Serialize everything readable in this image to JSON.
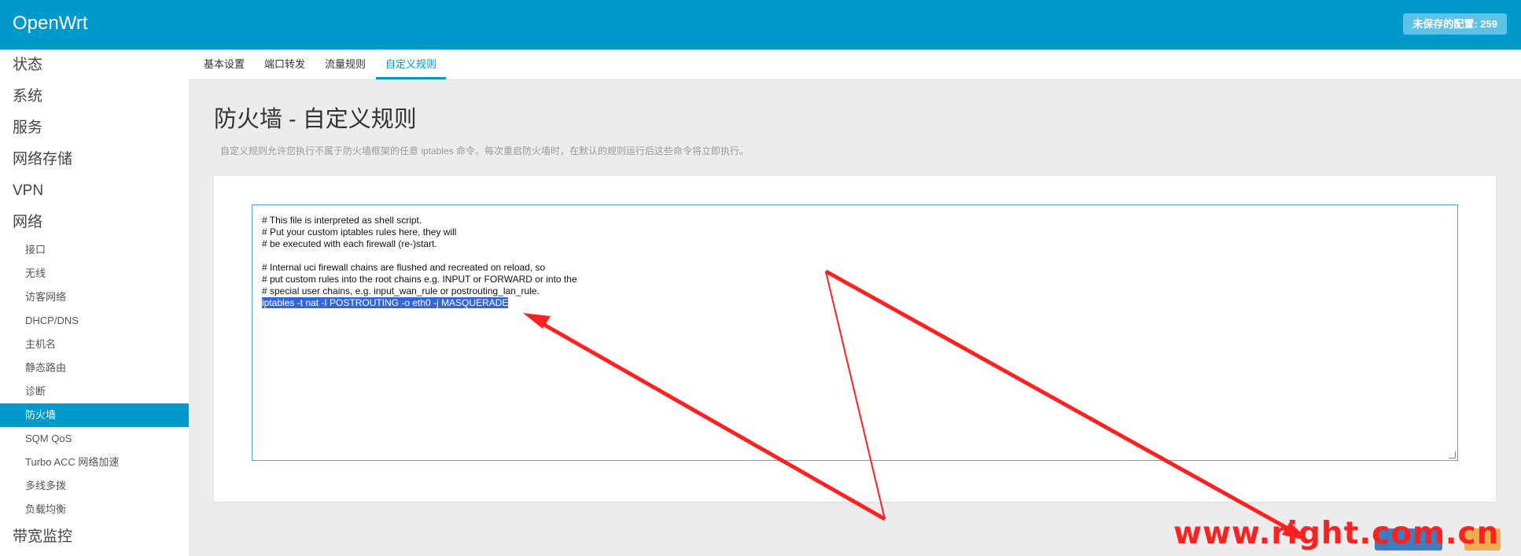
{
  "header": {
    "brand": "OpenWrt",
    "unsaved_badge": "未保存的配置: 259"
  },
  "sidebar": {
    "top_items": [
      "状态",
      "系统",
      "服务",
      "网络存储",
      "VPN",
      "网络"
    ],
    "network_items": [
      "接口",
      "无线",
      "访客网络",
      "DHCP/DNS",
      "主机名",
      "静态路由",
      "诊断",
      "防火墙",
      "SQM QoS",
      "Turbo ACC 网络加速",
      "多线多拨",
      "负载均衡"
    ],
    "active_item": "防火墙",
    "bottom_item": "带宽监控"
  },
  "tabs": [
    "基本设置",
    "端口转发",
    "流量规则",
    "自定义规则"
  ],
  "active_tab": "自定义规则",
  "page": {
    "title": "防火墙 - 自定义规则",
    "description": "自定义规则允许您执行不属于防火墙框架的任意 iptables 命令。每次重启防火墙时，在默认的规则运行后这些命令将立即执行。"
  },
  "editor": {
    "lines": [
      "# This file is interpreted as shell script.",
      "# Put your custom iptables rules here, they will",
      "# be executed with each firewall (re-)start.",
      "",
      "# Internal uci firewall chains are flushed and recreated on reload, so",
      "# put custom rules into the root chains e.g. INPUT or FORWARD or into the",
      "# special user chains, e.g. input_wan_rule or postrouting_lan_rule."
    ],
    "selected_line": "iptables -t nat -I POSTROUTING -o eth0 -j MASQUERADE"
  },
  "watermark": "www.right.com.cn",
  "colors": {
    "brand_blue": "#0099cc",
    "arrow_red": "#ff2020",
    "selection": "#3367d6"
  }
}
